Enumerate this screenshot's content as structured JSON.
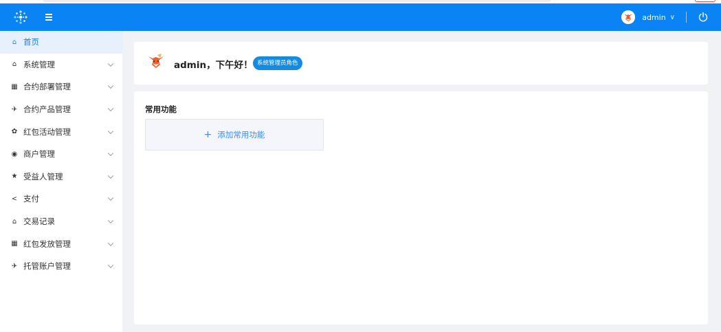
{
  "header": {
    "username": "admin",
    "user_caret": "∨"
  },
  "sidebar": {
    "items": [
      {
        "label": "首页",
        "icon": "home-icon",
        "glyph": "⌂"
      },
      {
        "label": "系统管理",
        "icon": "home-icon",
        "glyph": "⌂"
      },
      {
        "label": "合约部署管理",
        "icon": "grid-icon",
        "glyph": "▦"
      },
      {
        "label": "合约产品管理",
        "icon": "send-icon",
        "glyph": "✈"
      },
      {
        "label": "红包活动管理",
        "icon": "gear-icon",
        "glyph": "✿"
      },
      {
        "label": "商户管理",
        "icon": "circle-icon",
        "glyph": "◉"
      },
      {
        "label": "受益人管理",
        "icon": "star-icon",
        "glyph": "★"
      },
      {
        "label": "支付",
        "icon": "share-icon",
        "glyph": "<"
      },
      {
        "label": "交易记录",
        "icon": "home-icon",
        "glyph": "⌂"
      },
      {
        "label": "红包发放管理",
        "icon": "grid-icon",
        "glyph": "▦"
      },
      {
        "label": "托管账户管理",
        "icon": "send-icon",
        "glyph": "✈"
      }
    ]
  },
  "greeting": {
    "text": "admin，下午好！",
    "role": "系统管理员角色"
  },
  "functions": {
    "title": "常用功能",
    "add_plus": "+",
    "add_label": "添加常用功能"
  },
  "colors": {
    "header_bg": "#0a84f5",
    "active_bg": "#e6f1fd",
    "active_text": "#1a7ff0",
    "badge_bg": "#1689e0"
  }
}
